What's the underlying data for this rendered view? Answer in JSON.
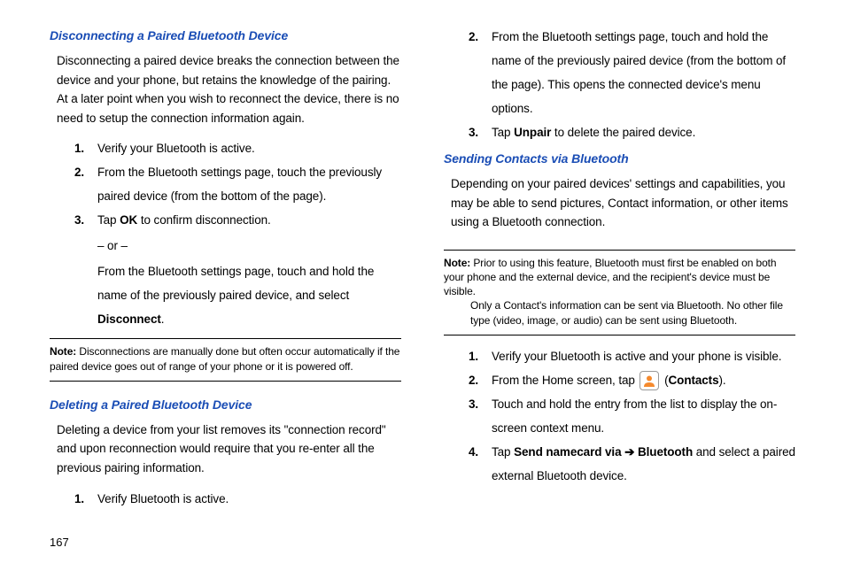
{
  "page_number": "167",
  "left": {
    "sec1_heading": "Disconnecting a Paired Bluetooth Device",
    "sec1_intro": "Disconnecting a paired device breaks the connection between the device and your phone, but retains the knowledge of the pairing. At a later point when you wish to reconnect the device, there is no need to setup the connection information again.",
    "sec1_step1": "Verify your Bluetooth is active.",
    "sec1_step2": "From the Bluetooth settings page, touch the previously paired device (from the bottom of the page).",
    "sec1_step3a": "Tap ",
    "sec1_step3_ok": "OK",
    "sec1_step3b": "  to confirm disconnection.",
    "sec1_or": "– or –",
    "sec1_step3c": "From the Bluetooth settings page, touch and hold the name of the previously paired device, and select ",
    "sec1_disconnect": "Disconnect",
    "sec1_period": ".",
    "note1_label": "Note:",
    "note1_body": "Disconnections are manually done but often occur automatically if the paired device goes out of range of your phone or it is powered off.",
    "sec2_heading": "Deleting a Paired Bluetooth Device",
    "sec2_intro": "Deleting a device from your list removes its \"connection record\" and upon reconnection would require that you re-enter all the previous pairing information.",
    "sec2_step1": "Verify Bluetooth is active."
  },
  "right": {
    "sec2_step2": "From the Bluetooth settings page, touch and hold the name of the previously paired device (from the bottom of the page). This opens the connected device's menu options.",
    "sec2_step3a": "Tap ",
    "sec2_step3_unpair": "Unpair",
    "sec2_step3b": " to delete the paired device.",
    "sec3_heading": "Sending Contacts via Bluetooth",
    "sec3_intro": "Depending on your paired devices' settings and capabilities, you may be able to send pictures, Contact information, or other items using a Bluetooth connection.",
    "note2_label": "Note:",
    "note2_body1": "Prior to using this feature, Bluetooth must first be enabled on both your phone and the external device, and the recipient's device must be visible.",
    "note2_body2": "Only a Contact's information can be sent via Bluetooth. No other file type (video, image, or audio) can be sent using Bluetooth.",
    "sec3_step1": "Verify your Bluetooth is active and your phone is visible.",
    "sec3_step2a": "From the Home screen, tap ",
    "sec3_step2b": "  (",
    "sec3_step2_contacts": "Contacts",
    "sec3_step2c": ").",
    "sec3_step3": "Touch and hold the entry from the list to display the on-screen context menu.",
    "sec3_step4a": "Tap ",
    "sec3_step4_send": "Send namecard via",
    "sec3_step4_arrow": " ➔ ",
    "sec3_step4_bt": "Bluetooth",
    "sec3_step4b": " and select a paired external Bluetooth device."
  }
}
